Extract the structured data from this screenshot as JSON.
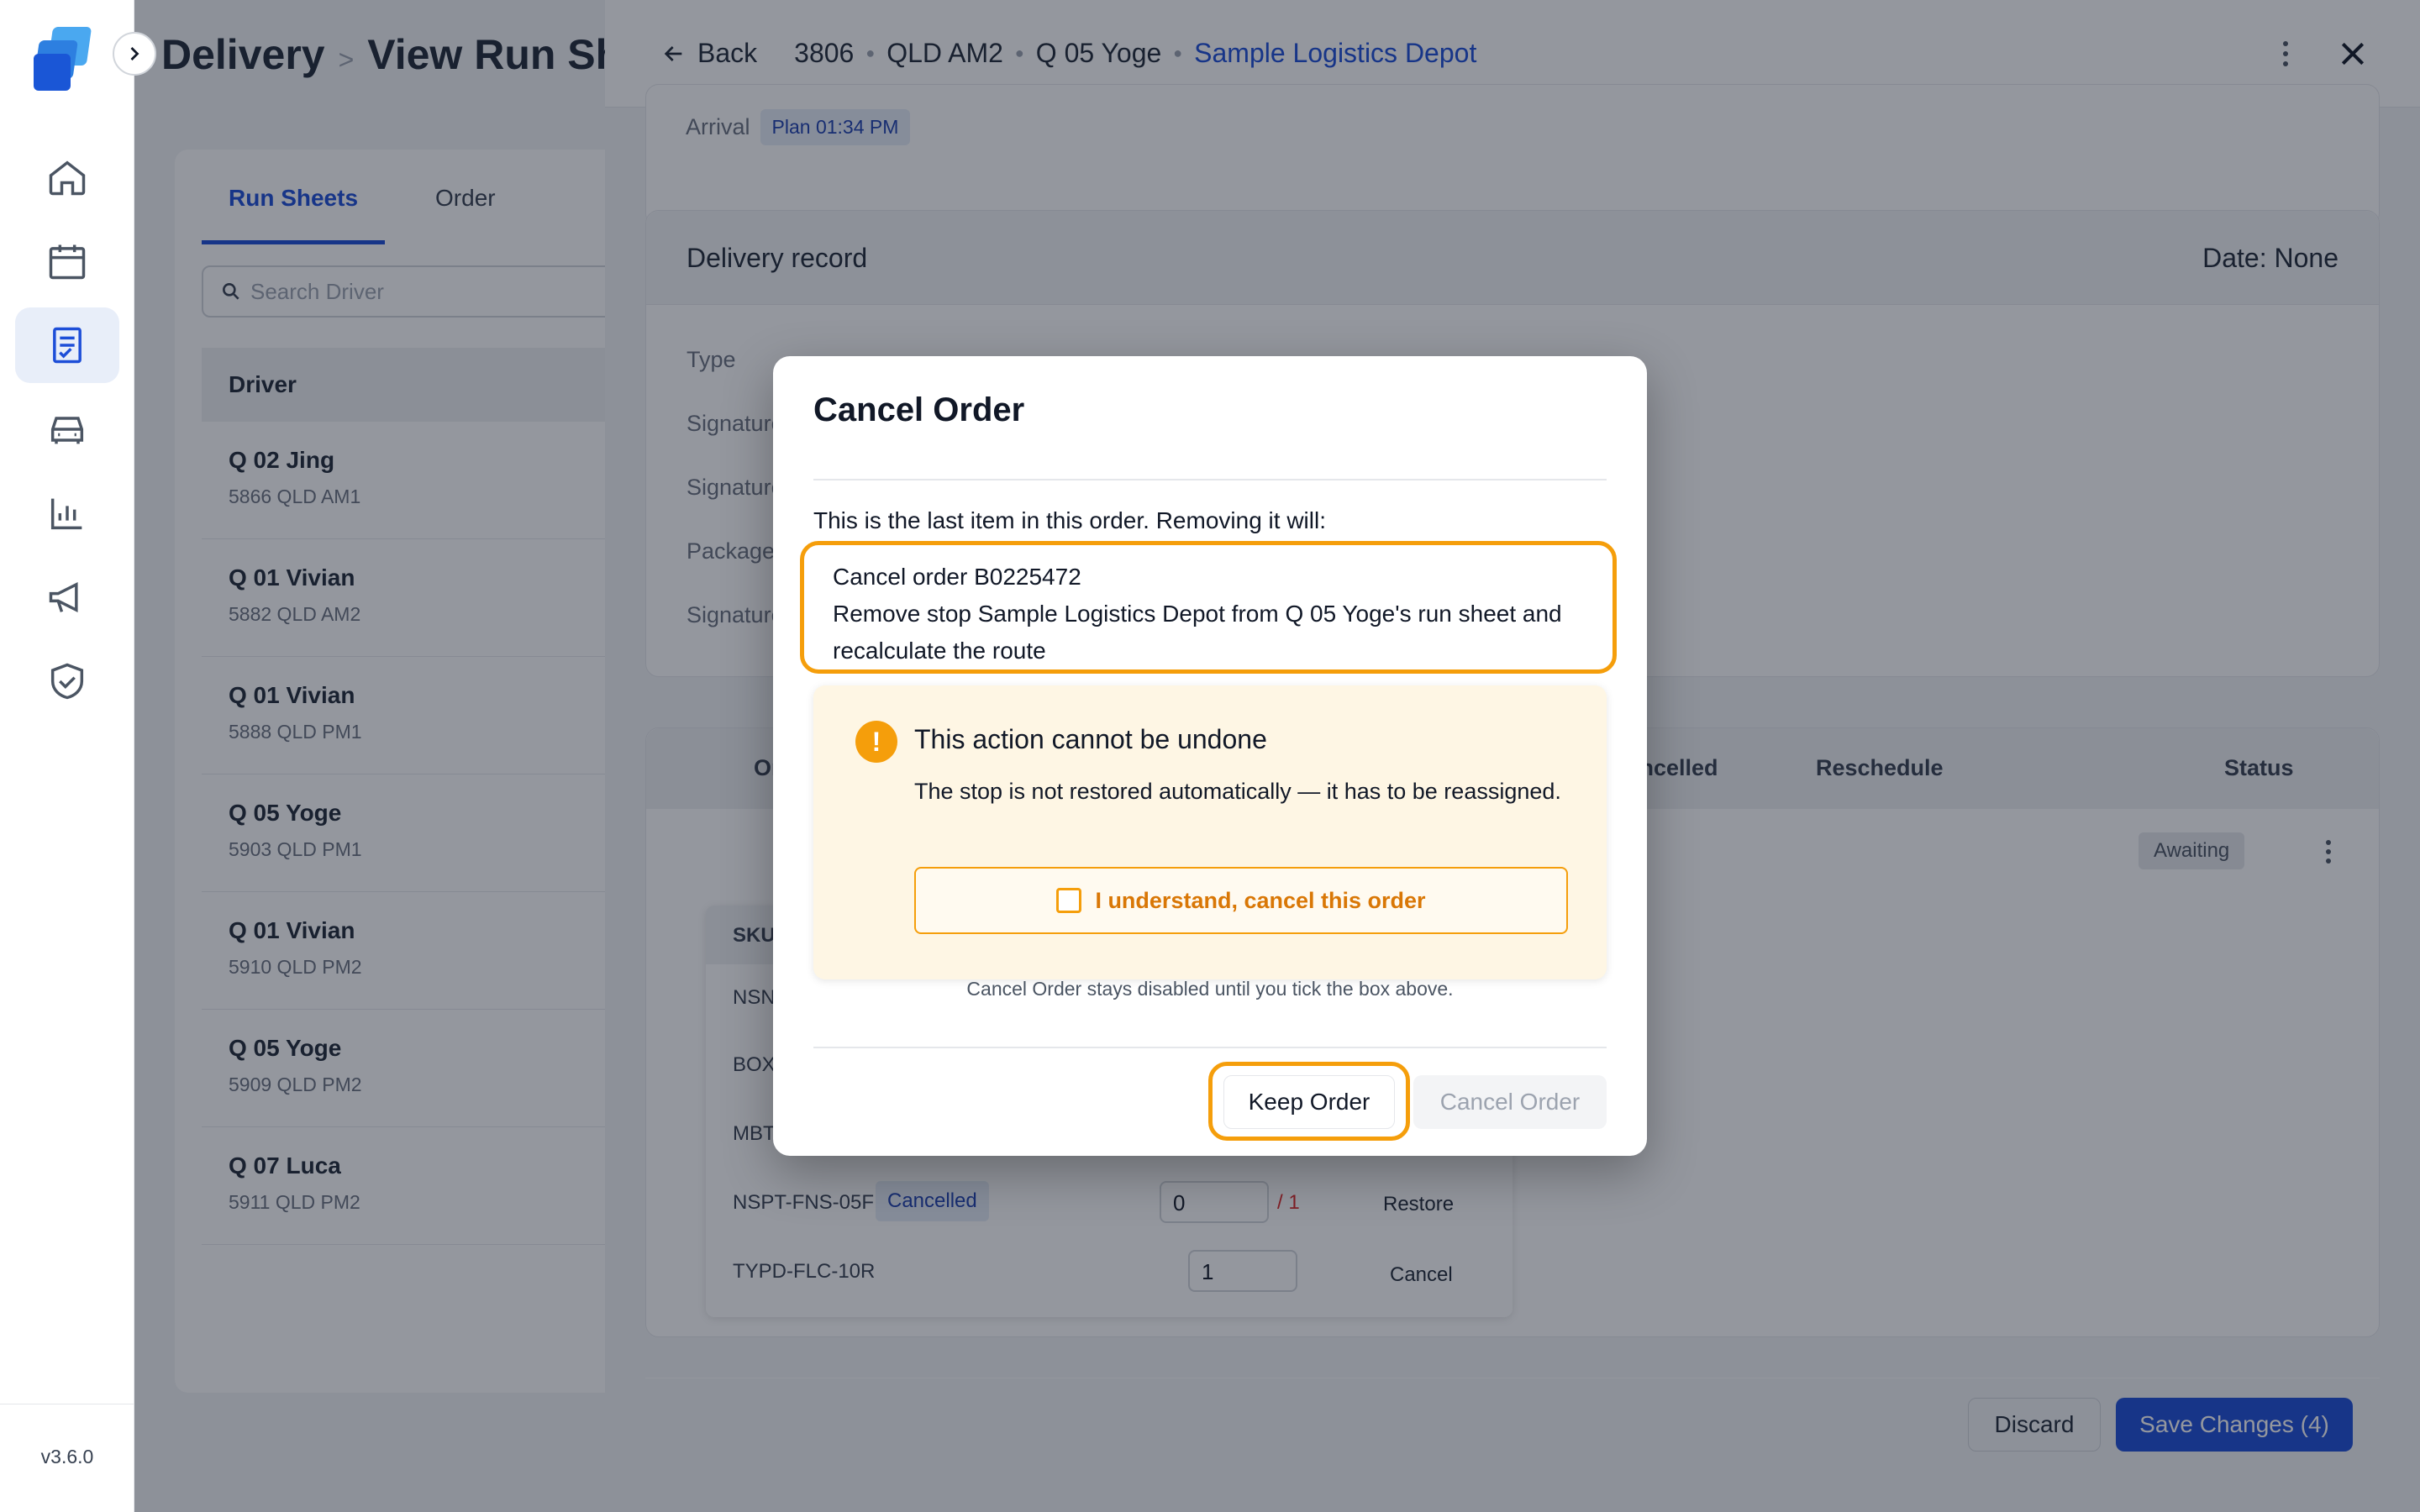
{
  "rail": {
    "version": "v3.6.0",
    "icons": [
      "home-icon",
      "calendar-icon",
      "runsheet-icon",
      "vehicle-icon",
      "chart-icon",
      "megaphone-icon",
      "shield-check-icon"
    ],
    "active_icon": "runsheet-icon"
  },
  "background": {
    "breadcrumb": [
      "Delivery",
      "View Run Sheets"
    ],
    "tabs": [
      {
        "label": "Run Sheets",
        "active": true
      },
      {
        "label": "Order",
        "active": false
      }
    ],
    "search_placeholder": "Search Driver",
    "driver_header": "Driver",
    "drivers": [
      {
        "name": "Q 02 Jing",
        "sub": "5866 QLD AM1"
      },
      {
        "name": "Q 01 Vivian",
        "sub": "5882 QLD AM2"
      },
      {
        "name": "Q 01 Vivian",
        "sub": "5888 QLD PM1"
      },
      {
        "name": "Q 05 Yoge",
        "sub": "5903 QLD PM1"
      },
      {
        "name": "Q 01 Vivian",
        "sub": "5910 QLD PM2"
      },
      {
        "name": "Q 05 Yoge",
        "sub": "5909 QLD PM2"
      },
      {
        "name": "Q 07 Luca",
        "sub": "5911 QLD PM2"
      }
    ]
  },
  "drawer": {
    "back_label": "Back",
    "crumbs": [
      "3806",
      "QLD AM2",
      "Q 05 Yoge"
    ],
    "crumb_link": "Sample Logistics Depot",
    "arrival_label": "Arrival",
    "arrival_plan": "Plan 01:34 PM",
    "record_title": "Delivery record",
    "record_date": "Date: None",
    "record_labels": [
      "Type",
      "Signature",
      "Signature",
      "Package",
      "Signature"
    ],
    "table_headers": {
      "order": "Order",
      "cancelled": "Cancelled",
      "reschedule": "Reschedule",
      "status": "Status"
    },
    "order_status": "Awaiting",
    "sub_header": "SKU",
    "sub_rows": [
      {
        "sku": "NSNT"
      },
      {
        "sku": "BOX"
      },
      {
        "sku": "MBT"
      },
      {
        "sku": "NSPT-FNS-05F",
        "tag": "Cancelled",
        "qty": "0",
        "max": "/ 1",
        "action": "Restore"
      },
      {
        "sku": "TYPD-FLC-10R",
        "qty": "1",
        "action": "Cancel"
      }
    ],
    "discard_label": "Discard",
    "save_label": "Save Changes (4)"
  },
  "modal": {
    "title": "Cancel Order",
    "intro": "This is the last item in this order. Removing it will:",
    "effect_1": "Cancel order B0225472",
    "effect_2": "Remove stop Sample Logistics Depot from Q 05 Yoge's run sheet and recalculate the route",
    "warning_title": "This action cannot be undone",
    "warning_text": "The stop is not restored automatically — it has to be reassigned.",
    "ack_label": "I understand, cancel this order",
    "hint": "Cancel Order stays disabled until you tick the box above.",
    "keep_label": "Keep Order",
    "cancel_label": "Cancel Order",
    "accent": "#f59e0b"
  }
}
